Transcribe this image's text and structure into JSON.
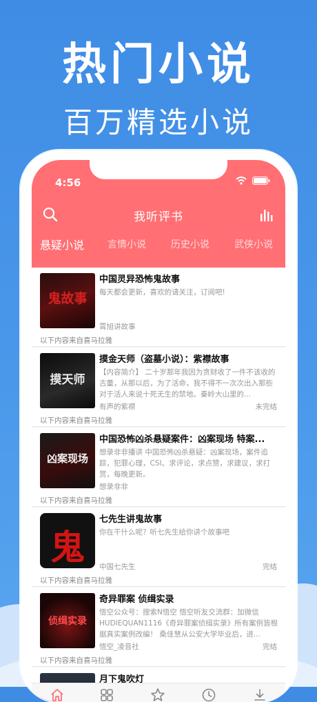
{
  "promo": {
    "title": "热门小说",
    "subtitle": "百万精选小说"
  },
  "status_bar": {
    "time": "4:56"
  },
  "header": {
    "title": "我听评书"
  },
  "tabs": [
    "悬疑小说",
    "言情小说",
    "历史小说",
    "武侠小说"
  ],
  "books": [
    {
      "title": "中国灵异恐怖鬼故事",
      "desc": "每天都会更新，喜欢的请关注，订阅吧!",
      "author": "霄旭讲故事",
      "status": "",
      "source": "以下内容来自喜马拉雅",
      "thumb_text": "鬼故事"
    },
    {
      "title": "摸金天师（盗墓小说）：紫襟故事",
      "desc": "【内容简介】 二十岁那年我因为贪财收了一件不该收的古董，从那以后，为了活命，我不得不一次次出入那些对于活人来说十死无生的禁地。秦岭大山里的...",
      "author": "有声的紫襟",
      "status": "未完结",
      "source": "以下内容来自喜马拉雅",
      "thumb_text": "摸天师"
    },
    {
      "title": "中国恐怖凶杀悬疑案件：凶案现场 特案...",
      "desc": "想录非非播讲 中国恐怖凶杀悬疑：凶案现场，案件追踪，犯罪心理，CSI。求评论，求点赞，求建议，求打赏，每晚更新。",
      "author": "想录非非",
      "status": "",
      "source": "以下内容来自喜马拉雅",
      "thumb_text": "凶案现场"
    },
    {
      "title": "七先生讲鬼故事",
      "desc": "你在干什么呢？听七先生给你讲个故事吧",
      "author": "中国七先生",
      "status": "完结",
      "source": "以下内容来自喜马拉雅",
      "thumb_text": "鬼"
    },
    {
      "title": "奇异罪案 侦缉实录",
      "desc": "悟空公众号：搜索N悟空 悟空听友交流群：加微信HUDIEQUAN1116《奇异罪案侦缉实录》所有案例皆根据真实案例改编！ 桑佳慧从公安大学毕业后，进...",
      "author": "悟空_凌音社",
      "status": "完结",
      "source": "以下内容来自喜马拉雅",
      "thumb_text": "侦缉实录"
    },
    {
      "title": "月下鬼吹灯",
      "desc": "",
      "author": "",
      "status": "",
      "source": "",
      "thumb_text": ""
    }
  ],
  "tabbar": [
    "home-icon",
    "grid-icon",
    "star-icon",
    "clock-icon",
    "download-icon"
  ],
  "colors": {
    "accent": "#ff6f73",
    "background": "#4a98ea"
  }
}
